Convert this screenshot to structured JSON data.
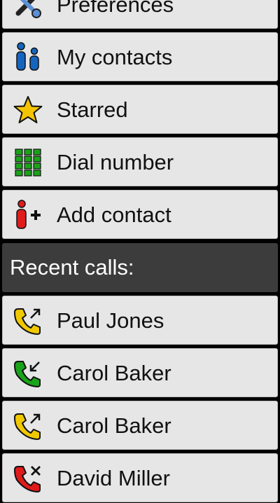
{
  "menu": {
    "items": [
      {
        "label": "Preferences",
        "icon": "wrench-screwdriver-icon"
      },
      {
        "label": "My contacts",
        "icon": "people-icon",
        "color": "#1565c0"
      },
      {
        "label": "Starred",
        "icon": "star-icon",
        "color": "#f5c400"
      },
      {
        "label": "Dial number",
        "icon": "dialpad-icon",
        "color": "#1aa31a"
      },
      {
        "label": "Add contact",
        "icon": "add-person-icon",
        "color": "#e01b1b"
      }
    ]
  },
  "recent": {
    "header": "Recent calls:",
    "calls": [
      {
        "name": "Paul Jones",
        "type": "outgoing",
        "icon": "outgoing-call-icon",
        "color": "#f0c800"
      },
      {
        "name": "Carol Baker",
        "type": "incoming",
        "icon": "incoming-call-icon",
        "color": "#19a319"
      },
      {
        "name": "Carol Baker",
        "type": "outgoing",
        "icon": "outgoing-call-icon",
        "color": "#f0c800"
      },
      {
        "name": "David Miller",
        "type": "missed",
        "icon": "missed-call-icon",
        "color": "#e01b1b"
      }
    ]
  }
}
